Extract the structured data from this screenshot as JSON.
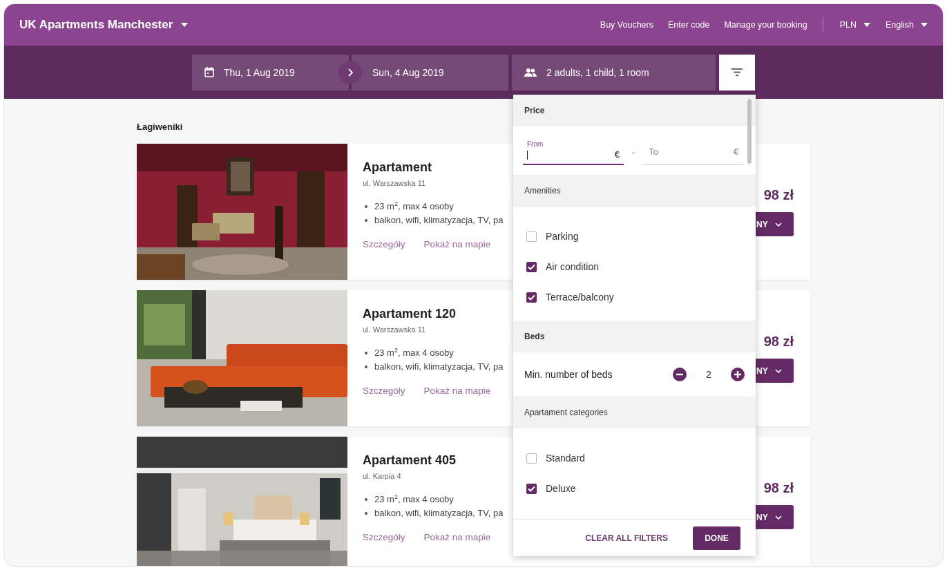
{
  "header": {
    "title": "UK Apartments Manchester",
    "links": [
      "Buy Vouchers",
      "Enter code",
      "Manage your booking"
    ],
    "currency": "PLN",
    "language": "English"
  },
  "search": {
    "check_in": "Thu, 1 Aug  2019",
    "check_out": "Sun, 4 Aug  2019",
    "guests": "2 adults, 1 child, 1 room"
  },
  "section_title": "Łagiweniki",
  "listings": [
    {
      "name": "Apartament",
      "address": "ul. Warszawska 11",
      "features": [
        "23 m$^{2}$, max 4 osoby",
        "balkon, wifi, klimatyzacja, TV, pa"
      ],
      "links": [
        "Szczegóły",
        "Pokaż na mapie"
      ],
      "price": "98 zł",
      "button": "NY"
    },
    {
      "name": "Apartament 120",
      "address": "ul. Warszawska 11",
      "features": [
        "23 m$^{2}$, max 4 osoby",
        "balkon, wifi, klimatyzacja, TV, pa"
      ],
      "links": [
        "Szczegóły",
        "Pokaż na mapie"
      ],
      "price": "98 zł",
      "button": "NY"
    },
    {
      "name": "Apartament 405",
      "address": "ul. Karpia 4",
      "features": [
        "23 m$^{2}$, max 4 osoby",
        "balkon, wifi, klimatyzacja, TV, pa"
      ],
      "links": [
        "Szczegóły",
        "Pokaż na mapie"
      ],
      "price": "98 zł",
      "button": "NY"
    }
  ],
  "filters": {
    "sections": [
      {
        "kind": "price",
        "title": "Price",
        "from": {
          "label": "From",
          "unit": "€"
        },
        "separator": "-",
        "to": {
          "placeholder": "To",
          "unit": "€"
        }
      },
      {
        "kind": "checklist",
        "title": "Amenities",
        "items": [
          {
            "label": "Parking",
            "checked": false
          },
          {
            "label": "Air condition",
            "checked": true
          },
          {
            "label": "Terrace/balcony",
            "checked": true
          }
        ]
      },
      {
        "kind": "stepper",
        "title": "Beds",
        "label": "Min. number of beds",
        "value": "2"
      },
      {
        "kind": "checklist",
        "title": "Apartament categories",
        "items": [
          {
            "label": "Standard",
            "checked": false
          },
          {
            "label": "Deluxe",
            "checked": true
          }
        ]
      }
    ],
    "buttons": [
      "CLEAR ALL FILTERS",
      "DONE"
    ]
  }
}
